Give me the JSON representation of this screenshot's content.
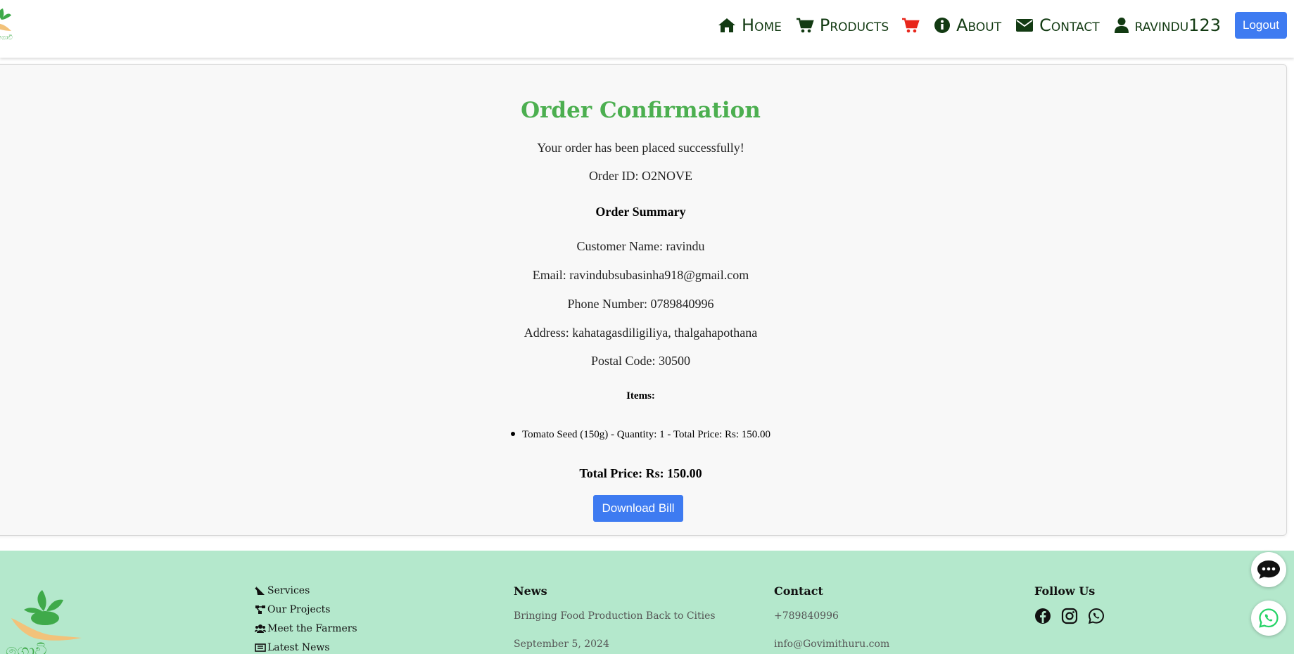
{
  "header": {
    "nav": {
      "home": "Home",
      "products": "Products",
      "about": "About",
      "contact": "Contact",
      "user": "ravindu123",
      "logout": "Logout"
    },
    "icons": [
      "home-icon",
      "cart-icon",
      "cart-icon",
      "info-icon",
      "envelope-icon",
      "user-icon"
    ],
    "cart_color": "#e8261b"
  },
  "order": {
    "title": "Order Confirmation",
    "success": "Your order has been placed successfully!",
    "order_id": "Order ID: O2NOVE",
    "summary_heading": "Order Summary",
    "customer_name": "Customer Name: ravindu",
    "email": "Email: ravindubsubasinha918@gmail.com",
    "phone": "Phone Number: 0789840996",
    "address": "Address: kahatagasdiligiliya, thalgahapothana",
    "postal_code": "Postal Code: 30500",
    "items_heading": "Items:",
    "items": [
      "Tomato Seed (150g) - Quantity: 1 - Total Price: Rs: 150.00"
    ],
    "total": "Total Price: Rs: 150.00",
    "download_label": "Download Bill",
    "title_color": "#4caf50",
    "button_color": "#3e7bf1"
  },
  "footer": {
    "services": [
      "Services",
      "Our Projects",
      "Meet the Farmers",
      "Latest News"
    ],
    "news": {
      "heading": "News",
      "headline": "Bringing Food Production Back to Cities",
      "date": "September 5, 2024"
    },
    "contact": {
      "heading": "Contact",
      "phone": "+789840996",
      "email": "info@Govimithuru.com"
    },
    "follow": {
      "heading": "Follow Us",
      "icons": [
        "facebook-icon",
        "instagram-icon",
        "whatsapp-icon"
      ]
    },
    "background": "#b4e8cc"
  }
}
